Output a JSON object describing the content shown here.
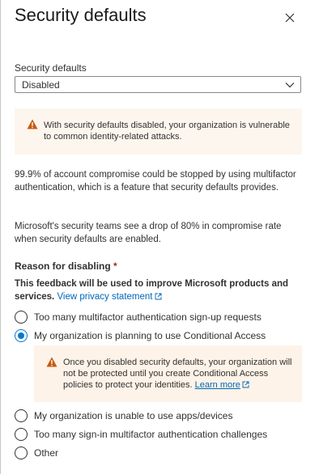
{
  "panel": {
    "title": "Security defaults"
  },
  "security_defaults_field": {
    "label": "Security defaults",
    "selected": "Disabled"
  },
  "warning_disabled": {
    "text": "With security defaults disabled, your organization is vulnerable to common identity-related attacks."
  },
  "info": {
    "paragraph1": "99.9% of account compromise could be stopped by using multifactor authentication, which is a feature that security defaults provides.",
    "paragraph2": "Microsoft's security teams see a drop of 80% in compromise rate when security defaults are enabled."
  },
  "reason": {
    "label": "Reason for disabling",
    "required_marker": "*",
    "feedback_text": "This feedback will be used to improve Microsoft products and services.",
    "privacy_link": "View privacy statement"
  },
  "options": [
    {
      "label": "Too many multifactor authentication sign-up requests",
      "checked": false
    },
    {
      "label": "My organization is planning to use Conditional Access",
      "checked": true
    },
    {
      "label": "My organization is unable to use apps/devices",
      "checked": false
    },
    {
      "label": "Too many sign-in multifactor authentication challenges",
      "checked": false
    },
    {
      "label": "Other",
      "checked": false
    }
  ],
  "warning_conditional": {
    "text": "Once you disabled security defaults, your organization will not be protected until you create Conditional Access policies to protect your identities.",
    "learn_more": "Learn more"
  },
  "icons": {
    "close": "close-icon",
    "chevron": "chevron-down-icon",
    "warning": "warning-icon",
    "external": "external-link-icon"
  },
  "colors": {
    "accent": "#0078d4",
    "link": "#0067b8",
    "warning_bg": "#fdf6ee",
    "warning_icon": "#c55a11",
    "required": "#a4262c"
  }
}
